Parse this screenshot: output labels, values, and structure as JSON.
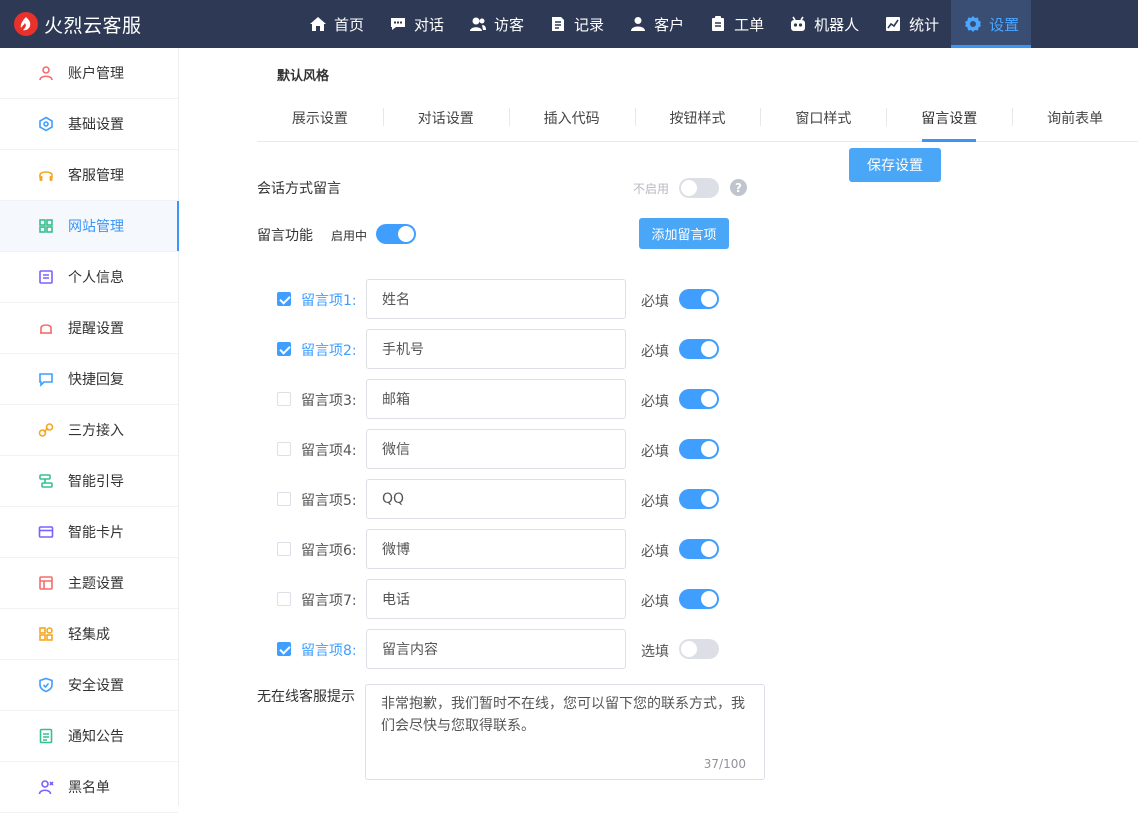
{
  "brand": {
    "name": "火烈云客服"
  },
  "nav": [
    {
      "label": "首页",
      "icon": "home-icon"
    },
    {
      "label": "对话",
      "icon": "chat-icon"
    },
    {
      "label": "访客",
      "icon": "visitors-icon"
    },
    {
      "label": "记录",
      "icon": "record-icon"
    },
    {
      "label": "客户",
      "icon": "customer-icon"
    },
    {
      "label": "工单",
      "icon": "ticket-icon"
    },
    {
      "label": "机器人",
      "icon": "robot-icon"
    },
    {
      "label": "统计",
      "icon": "stats-icon"
    },
    {
      "label": "设置",
      "icon": "gear-icon",
      "active": true
    }
  ],
  "sidebar": {
    "items": [
      {
        "label": "账户管理",
        "icon": "account-icon",
        "color": "#f56c6c"
      },
      {
        "label": "基础设置",
        "icon": "basic-settings-icon",
        "color": "#409eff"
      },
      {
        "label": "客服管理",
        "icon": "headset-icon",
        "color": "#f5a623"
      },
      {
        "label": "网站管理",
        "icon": "grid-icon",
        "color": "#36c08e",
        "active": true
      },
      {
        "label": "个人信息",
        "icon": "profile-icon",
        "color": "#7b61ff"
      },
      {
        "label": "提醒设置",
        "icon": "bell-icon",
        "color": "#f56c6c"
      },
      {
        "label": "快捷回复",
        "icon": "message-icon",
        "color": "#409eff"
      },
      {
        "label": "三方接入",
        "icon": "link-icon",
        "color": "#f5a623"
      },
      {
        "label": "智能引导",
        "icon": "guide-icon",
        "color": "#36c08e"
      },
      {
        "label": "智能卡片",
        "icon": "card-icon",
        "color": "#7b61ff"
      },
      {
        "label": "主题设置",
        "icon": "theme-icon",
        "color": "#f56c6c"
      },
      {
        "label": "轻集成",
        "icon": "integration-icon",
        "color": "#f5a623"
      },
      {
        "label": "安全设置",
        "icon": "shield-icon",
        "color": "#409eff"
      },
      {
        "label": "通知公告",
        "icon": "notice-icon",
        "color": "#36c08e"
      },
      {
        "label": "黑名单",
        "icon": "blacklist-icon",
        "color": "#7b61ff"
      }
    ]
  },
  "main": {
    "section_title": "默认风格",
    "tabs": [
      {
        "label": "展示设置"
      },
      {
        "label": "对话设置"
      },
      {
        "label": "插入代码"
      },
      {
        "label": "按钮样式"
      },
      {
        "label": "窗口样式"
      },
      {
        "label": "留言设置",
        "active": true
      },
      {
        "label": "询前表单"
      }
    ],
    "save_label": "保存设置",
    "session_message": {
      "label": "会话方式留言",
      "status": "不启用",
      "enabled": false,
      "help": "?"
    },
    "message_feature": {
      "label": "留言功能",
      "status": "启用中",
      "enabled": true
    },
    "add_item_label": "添加留言项",
    "fields": [
      {
        "label": "留言项1:",
        "value": "姓名",
        "checked": true,
        "req_label": "必填",
        "required": true
      },
      {
        "label": "留言项2:",
        "value": "手机号",
        "checked": true,
        "req_label": "必填",
        "required": true
      },
      {
        "label": "留言项3:",
        "value": "邮箱",
        "checked": false,
        "req_label": "必填",
        "required": true
      },
      {
        "label": "留言项4:",
        "value": "微信",
        "checked": false,
        "req_label": "必填",
        "required": true
      },
      {
        "label": "留言项5:",
        "value": "QQ",
        "checked": false,
        "req_label": "必填",
        "required": true
      },
      {
        "label": "留言项6:",
        "value": "微博",
        "checked": false,
        "req_label": "必填",
        "required": true
      },
      {
        "label": "留言项7:",
        "value": "电话",
        "checked": false,
        "req_label": "必填",
        "required": true
      },
      {
        "label": "留言项8:",
        "value": "留言内容",
        "checked": true,
        "req_label": "选填",
        "required": false
      }
    ],
    "offline": {
      "label": "无在线客服提示",
      "text": "非常抱歉，我们暂时不在线，您可以留下您的联系方式，我们会尽快与您取得联系。",
      "counter": "37/100"
    }
  }
}
